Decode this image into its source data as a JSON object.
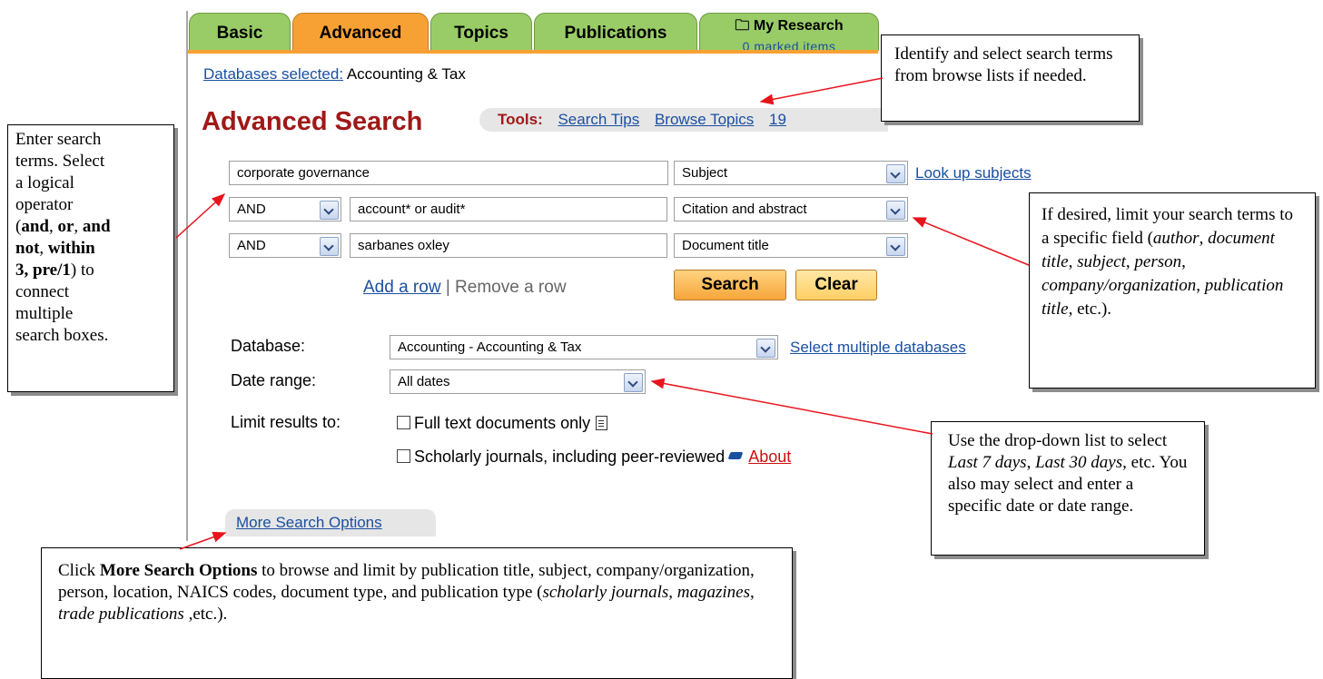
{
  "tabs": [
    "Basic",
    "Advanced",
    "Topics",
    "Publications"
  ],
  "my_research": {
    "label": "My Research",
    "sub": "0 marked items"
  },
  "databases": {
    "label": "Databases selected:",
    "value": " Accounting & Tax"
  },
  "page_title": "Advanced Search",
  "tools": {
    "label": "Tools:",
    "items": [
      "Search Tips",
      "Browse Topics",
      "19"
    ]
  },
  "rows": [
    {
      "term": "corporate governance",
      "field": "Subject",
      "link": "Look up subjects"
    },
    {
      "op": "AND",
      "term": "account* or audit*",
      "field": "Citation and abstract"
    },
    {
      "op": "AND",
      "term": "sarbanes oxley",
      "field": "Document title"
    }
  ],
  "row_actions": {
    "add": "Add a row",
    "sep": " | ",
    "remove": "Remove a row"
  },
  "buttons": {
    "search": "Search",
    "clear": "Clear"
  },
  "database": {
    "label": "Database:",
    "value": "Accounting - Accounting & Tax",
    "link": "Select multiple databases"
  },
  "date_range": {
    "label": "Date range:",
    "value": "All dates"
  },
  "limits": {
    "label": "Limit results to:",
    "full_text": "Full text documents only",
    "scholarly": "Scholarly journals, including peer-reviewed",
    "about": "About"
  },
  "more_options": "More Search Options",
  "callouts": {
    "left": [
      "Enter search",
      "terms. Select",
      "a logical",
      "operator"
    ],
    "tools_text": "Identify and select search terms from browse lists if needed.",
    "date_text2": "You also may select and enter a specific date or date range."
  },
  "colors": {
    "tab_green": "#99cc66",
    "tab_orange": "#f7a135",
    "title_red": "#a01818",
    "link_blue": "#1a4fa0",
    "arrow_red": "#e8141c"
  }
}
